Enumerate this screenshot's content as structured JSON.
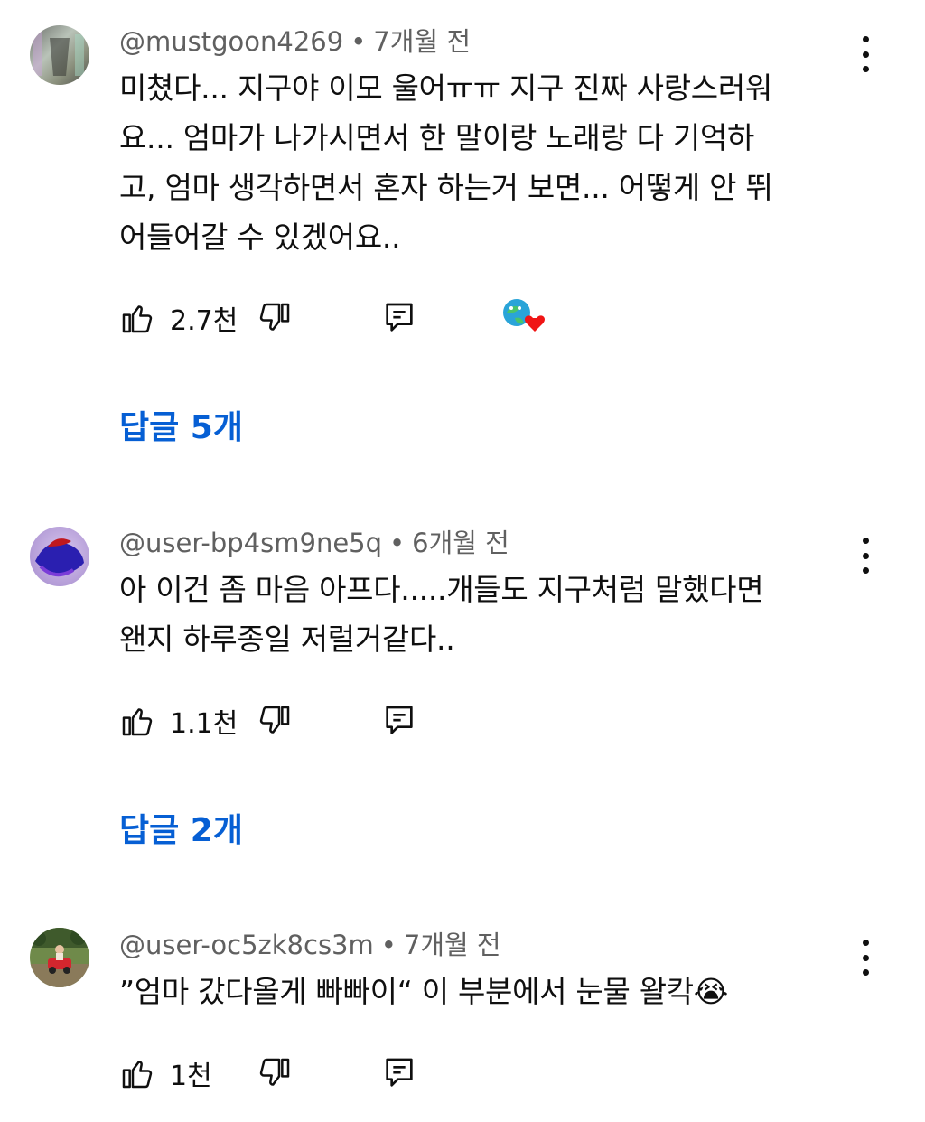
{
  "comments": [
    {
      "author": "@mustgoon4269",
      "separator": "•",
      "time": "7개월 전",
      "text": "미쳤다... 지구야 이모 울어ㅠㅠ 지구 진짜 사랑스러워\n요...  엄마가 나가시면서 한 말이랑 노래랑 다 기억하\n고, 엄마 생각하면서 혼자 하는거 보면...  어떻게  안 뛰\n어들어갈 수 있겠어요..",
      "likes": "2.7천",
      "replies": "답글 5개",
      "creator_heart": true
    },
    {
      "author": "@user-bp4sm9ne5q",
      "separator": "•",
      "time": "6개월 전",
      "text": "아 이건 좀 마음 아프다.....개들도 지구처럼 말했다면\n왠지 하루종일 저럴거같다..",
      "likes": "1.1천",
      "replies": "답글 2개",
      "creator_heart": false
    },
    {
      "author": "@user-oc5zk8cs3m",
      "separator": "•",
      "time": "7개월 전",
      "text": "”엄마 갔다올게 빠빠이“ 이 부분에서 눈물 왈칵😭",
      "likes": "1천",
      "replies": "",
      "creator_heart": false
    }
  ],
  "icons": {
    "like": "thumbs-up-icon",
    "dislike": "thumbs-down-icon",
    "reply": "reply-comment-icon",
    "menu": "more-vertical-icon",
    "heart": "creator-heart-icon"
  },
  "colors": {
    "link": "#065fd4",
    "meta": "#606060",
    "text": "#0f0f0f",
    "heart": "#ff0000"
  }
}
